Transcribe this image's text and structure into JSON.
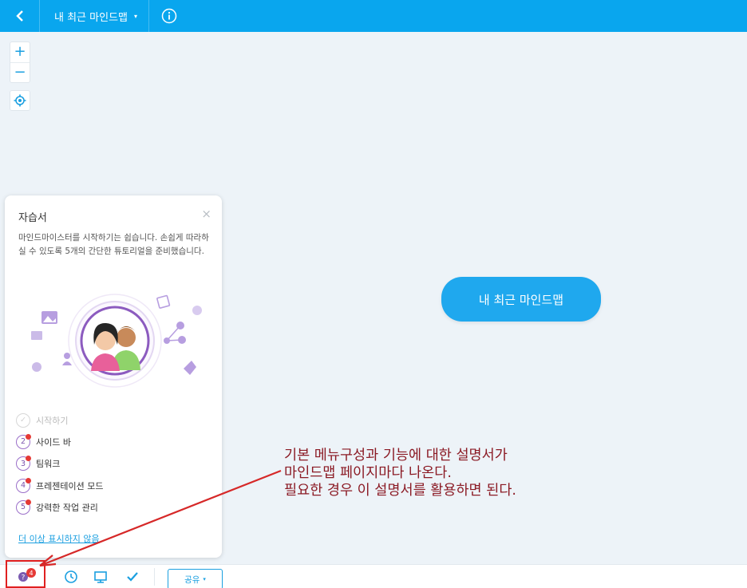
{
  "topbar": {
    "title": "내 최근 마인드맵",
    "title_caret": "▾",
    "bg_color": "#09a6ee"
  },
  "zoom": {
    "in_label": "+",
    "out_label": "−"
  },
  "canvas": {
    "central_node": "내 최근 마인드맵",
    "node_color": "#1fa8ee"
  },
  "tutorial": {
    "title": "자습서",
    "close_label": "×",
    "description": "마인드마이스터를 시작하기는 쉽습니다. 손쉽게 따라하실 수 있도록 5개의 간단한 튜토리얼을 준비했습니다.",
    "steps": [
      {
        "number": "✓",
        "label": "시작하기",
        "done": true
      },
      {
        "number": "2",
        "label": "사이드 바",
        "done": false
      },
      {
        "number": "3",
        "label": "팀워크",
        "done": false
      },
      {
        "number": "4",
        "label": "프레젠테이션 모드",
        "done": false
      },
      {
        "number": "5",
        "label": "강력한 작업 관리",
        "done": false
      }
    ],
    "hide_link": "더 이상 표시하지 않음"
  },
  "bottombar": {
    "help_badge": "4",
    "share_label": "공유",
    "share_caret": "▾"
  },
  "annotation": {
    "lines": [
      "기본 메뉴구성과 기능에 대한 설명서가",
      "마인드맵 페이지마다 나온다.",
      "필요한 경우 이 설명서를 활용하면 된다."
    ],
    "color": "#8b1a24",
    "highlight_color": "#e02020"
  }
}
